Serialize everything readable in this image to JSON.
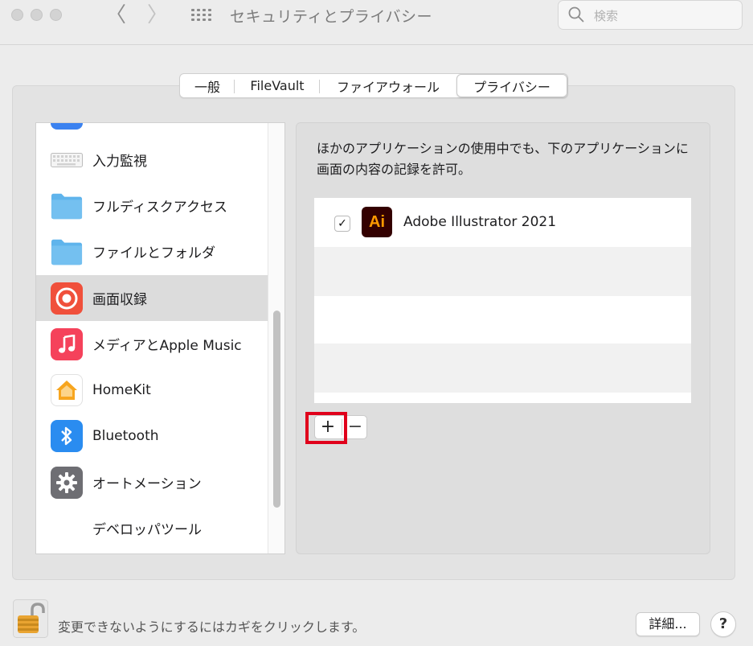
{
  "window": {
    "title": "セキュリティとプライバシー",
    "search_placeholder": "検索",
    "back_symbol": "〈",
    "forward_symbol": "〉"
  },
  "tabs": [
    {
      "label": "一般",
      "active": false
    },
    {
      "label": "FileVault",
      "active": false
    },
    {
      "label": "ファイアウォール",
      "active": false
    },
    {
      "label": "プライバシー",
      "active": true
    }
  ],
  "sidebar": {
    "items": [
      {
        "label": "入力監視",
        "icon": "keyboard-icon",
        "selected": false
      },
      {
        "label": "フルディスクアクセス",
        "icon": "folder-icon",
        "selected": false
      },
      {
        "label": "ファイルとフォルダ",
        "icon": "folder-icon",
        "selected": false
      },
      {
        "label": "画面収録",
        "icon": "screen-record-icon",
        "selected": true
      },
      {
        "label": "メディアとApple Music",
        "icon": "music-icon",
        "selected": false
      },
      {
        "label": "HomeKit",
        "icon": "home-icon",
        "selected": false
      },
      {
        "label": "Bluetooth",
        "icon": "bluetooth-icon",
        "selected": false
      },
      {
        "label": "オートメーション",
        "icon": "gear-icon",
        "selected": false
      },
      {
        "label": "デベロッパツール",
        "icon": "",
        "selected": false
      }
    ]
  },
  "main": {
    "description": "ほかのアプリケーションの使用中でも、下のアプリケーションに画面の内容の記録を許可。",
    "apps": [
      {
        "name": "Adobe Illustrator 2021",
        "icon_text": "Ai",
        "checked": true,
        "checkmark": "✓"
      }
    ],
    "add_label": "+",
    "remove_label": "−"
  },
  "footer": {
    "lock_text": "変更できないようにするにはカギをクリックします。",
    "details_label": "詳細...",
    "help_label": "?"
  },
  "colors": {
    "highlight_box": "#e0001b",
    "folder_blue": "#5fb4ec",
    "record_red": "#f0503b",
    "music_red": "#f5425b",
    "bluetooth_blue": "#2a8cf0",
    "illustrator_bg": "#330000",
    "illustrator_fg": "#ff9a00"
  }
}
